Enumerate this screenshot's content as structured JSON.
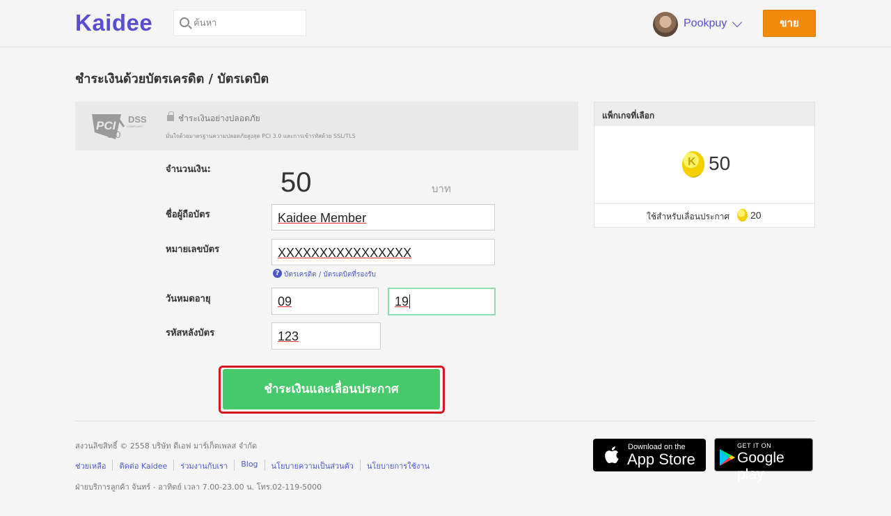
{
  "header": {
    "logo": "Kaidee",
    "search_placeholder": "ค้นหา",
    "user_name": "Pookpuy",
    "sell_label": "ขาย"
  },
  "page": {
    "title": "ชำระเงินด้วยบัตรเครดิต / บัตรเดบิต"
  },
  "secure": {
    "logo_text": "PCI DSS 3.0",
    "title": "ชำระเงินอย่างปลอดภัย",
    "desc": "มั่นใจด้วยมาตรฐานความปลอดภัยสูงสุด PCI 3.0 และการเข้ารหัสด้วย SSL/TLS"
  },
  "form": {
    "amount_label": "จำนวนเงิน:",
    "amount_value": "50",
    "amount_unit": "บาท",
    "cardholder_label": "ชื่อผู้ถือบัตร",
    "cardholder_value": "Kaidee Member",
    "card_number_label": "หมายเลขบัตร",
    "card_number_value": "XXXXXXXXXXXXXXXX",
    "supported_cards_link": "บัตรเครดิต / บัตรเดบิตที่รองรับ",
    "expiry_label": "วันหมดอายุ",
    "expiry_month": "09",
    "expiry_year": "19",
    "cvv_label": "รหัสหลังบัตร",
    "cvv_value": "123",
    "submit_label": "ชำระเงินและเลื่อนประกาศ"
  },
  "package": {
    "title": "แพ็กเกจที่เลือก",
    "coins": "50",
    "note": "ใช้สำหรับเลื่อนประกาศ",
    "note_coins": "20"
  },
  "footer": {
    "copyright": "สงวนลิขสิทธิ์ © 2558 บริษัท ดีเอฟ มาร์เก็ตเพลส จำกัด",
    "links": [
      "ช่วยเหลือ",
      "ติดต่อ Kaidee",
      "ร่วมงานกับเรา",
      "Blog",
      "นโยบายความเป็นส่วนตัว",
      "นโยบายการใช้งาน"
    ],
    "service_hours": "ฝ่ายบริการลูกค้า จันทร์ - อาทิตย์ เวลา 7.00-23.00 น. โทร.02-119-5000",
    "appstore_small": "Download on the",
    "appstore_big": "App Store",
    "googleplay_small": "GET IT ON",
    "googleplay_big": "Google play"
  },
  "colors": {
    "brand": "#5a4dd0",
    "sell_button": "#f28b0c",
    "submit_button": "#46c96a",
    "highlight": "#d8141c"
  }
}
